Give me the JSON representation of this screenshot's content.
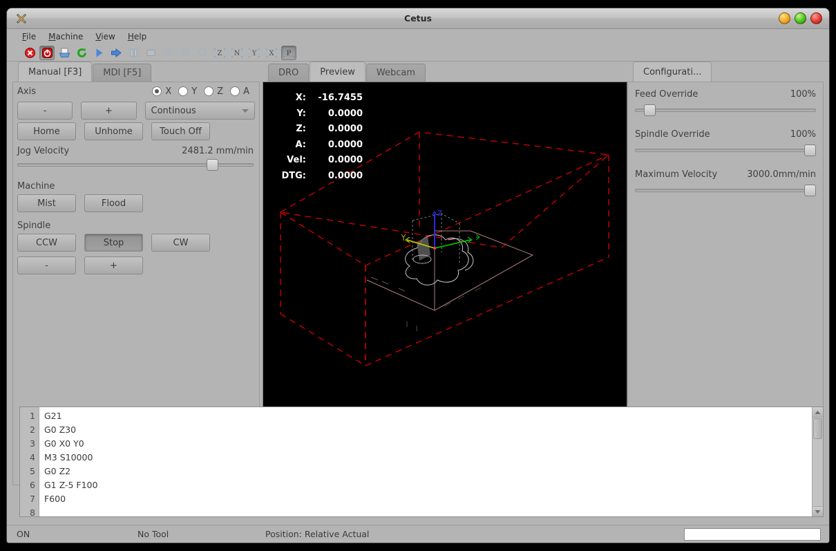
{
  "window": {
    "title": "Cetus",
    "app_icon": "app-logo-icon",
    "buttons": {
      "minimize": "minimize-button",
      "maximize": "maximize-button",
      "close": "close-button"
    }
  },
  "menubar": {
    "items": [
      "File",
      "Machine",
      "View",
      "Help"
    ]
  },
  "toolbar": {
    "items": [
      {
        "name": "estop-icon",
        "pressed": false
      },
      {
        "name": "power-icon",
        "pressed": true
      },
      {
        "name": "open-file-icon",
        "pressed": false
      },
      {
        "name": "reload-icon",
        "pressed": false
      },
      {
        "name": "run-icon",
        "pressed": false
      },
      {
        "name": "step-icon",
        "pressed": false
      },
      {
        "name": "pause-icon",
        "pressed": false
      },
      {
        "name": "stop-icon",
        "pressed": false
      },
      {
        "name": "zoom-out-icon",
        "pressed": false
      },
      {
        "name": "zoom-in-icon",
        "pressed": false
      },
      {
        "name": "zoom-fit-icon",
        "pressed": false
      },
      {
        "name": "view-z-icon",
        "label": "Z",
        "pressed": false
      },
      {
        "name": "view-iso-icon",
        "label": "N",
        "pressed": false
      },
      {
        "name": "view-y-icon",
        "label": "Y",
        "pressed": false
      },
      {
        "name": "view-x-icon",
        "label": "X",
        "pressed": false
      },
      {
        "name": "view-p-icon",
        "label": "P",
        "pressed": true
      }
    ]
  },
  "left_panel": {
    "tabs": [
      {
        "label": "Manual [F3]",
        "active": true
      },
      {
        "label": "MDI [F5]",
        "active": false
      }
    ],
    "axis": {
      "label": "Axis",
      "options": [
        {
          "label": "X",
          "selected": true
        },
        {
          "label": "Y",
          "selected": false
        },
        {
          "label": "Z",
          "selected": false
        },
        {
          "label": "A",
          "selected": false
        }
      ]
    },
    "jog": {
      "minus_label": "-",
      "plus_label": "+",
      "mode": "Continous"
    },
    "home_row": {
      "home_label": "Home",
      "unhome_label": "Unhome",
      "touchoff_label": "Touch Off"
    },
    "jog_velocity": {
      "label": "Jog Velocity",
      "value": "2481.2 mm/min",
      "percent": 82
    },
    "machine": {
      "label": "Machine",
      "mist_label": "Mist",
      "flood_label": "Flood"
    },
    "spindle": {
      "label": "Spindle",
      "ccw_label": "CCW",
      "stop_label": "Stop",
      "cw_label": "CW",
      "minus_label": "-",
      "plus_label": "+",
      "stop_pressed": true
    }
  },
  "center_panel": {
    "tabs": [
      {
        "label": "DRO",
        "active": false
      },
      {
        "label": "Preview",
        "active": true
      },
      {
        "label": "Webcam",
        "active": false
      }
    ],
    "dro": [
      {
        "key": "X:",
        "value": "-16.7455"
      },
      {
        "key": "Y:",
        "value": "0.0000"
      },
      {
        "key": "Z:",
        "value": "0.0000"
      },
      {
        "key": "A:",
        "value": "0.0000"
      },
      {
        "key": "Vel:",
        "value": "0.0000"
      },
      {
        "key": "DTG:",
        "value": "0.0000"
      }
    ],
    "viewport": {
      "background": "#000000",
      "envelope_color": "#cc0000",
      "toolpath_color": "#b08080",
      "axis_x_color": "#00c000",
      "axis_y_color": "#c0c000",
      "axis_z_color": "#3030ff"
    }
  },
  "right_panel": {
    "tabs": [
      {
        "label": "Configurati...",
        "active": true
      }
    ],
    "controls": [
      {
        "label": "Feed Override",
        "value": "100%",
        "percent": 6
      },
      {
        "label": "Spindle Override",
        "value": "100%",
        "percent": 97
      },
      {
        "label": "Maximum Velocity",
        "value": "3000.0mm/min",
        "percent": 97
      }
    ]
  },
  "editor": {
    "lines": [
      {
        "no": "1",
        "text": "G21"
      },
      {
        "no": "2",
        "text": "G0 Z30"
      },
      {
        "no": "3",
        "text": "G0 X0 Y0"
      },
      {
        "no": "4",
        "text": "M3 S10000"
      },
      {
        "no": "5",
        "text": "G0 Z2"
      },
      {
        "no": "6",
        "text": "G1 Z-5 F100"
      },
      {
        "no": "7",
        "text": "F600"
      },
      {
        "no": "8",
        "text": ""
      }
    ]
  },
  "statusbar": {
    "state": "ON",
    "tool": "No Tool",
    "position_mode": "Position: Relative Actual",
    "input_value": "",
    "input_placeholder": ""
  }
}
